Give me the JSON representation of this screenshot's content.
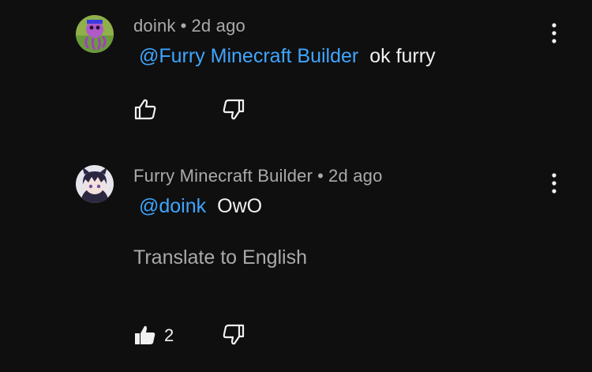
{
  "comments": [
    {
      "author": "doink",
      "separator": "•",
      "time": "2d ago",
      "mention": "@Furry Minecraft Builder",
      "text": "ok furry",
      "like_count": ""
    },
    {
      "author": "Furry Minecraft Builder",
      "separator": "•",
      "time": "2d ago",
      "mention": "@doink",
      "text": "OwO",
      "translate": "Translate to English",
      "like_count": "2"
    }
  ],
  "icons": {
    "like": "thumb-up-icon",
    "dislike": "thumb-down-icon",
    "more": "more-vert-icon"
  },
  "colors": {
    "background": "#0f0f0f",
    "mention": "#3ea6ff",
    "meta": "#aaaaaa",
    "text": "#f1f1f1"
  }
}
